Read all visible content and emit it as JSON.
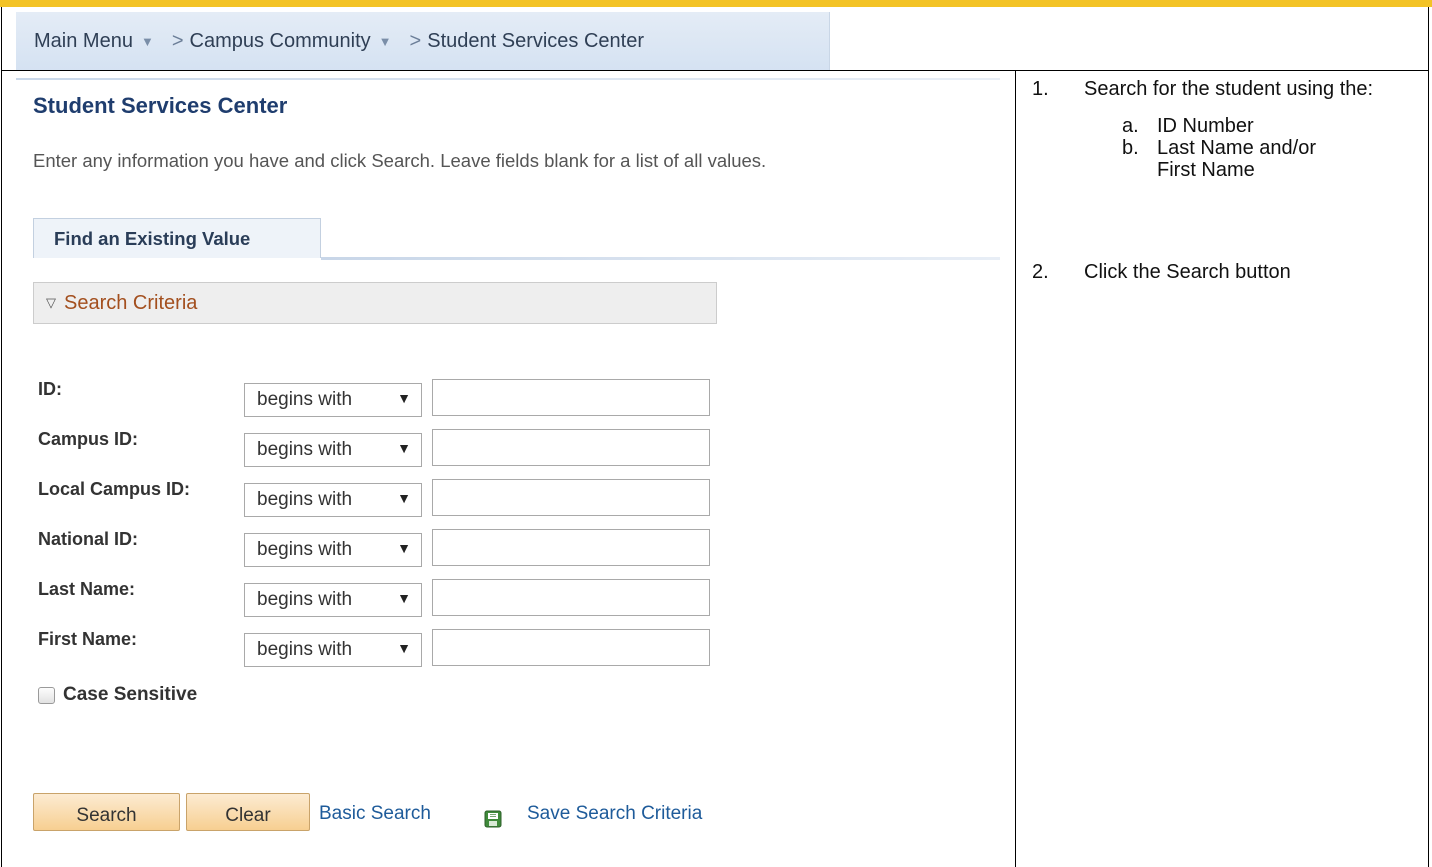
{
  "breadcrumb": {
    "items": [
      "Main Menu",
      "Campus Community",
      "Student Services Center"
    ]
  },
  "page": {
    "title": "Student Services Center",
    "instructions": "Enter any information you have and click Search. Leave fields blank for a list of all values."
  },
  "tab": {
    "label": "Find an Existing Value"
  },
  "criteria": {
    "header": "Search Criteria"
  },
  "fields": [
    {
      "label": "ID:",
      "operator": "begins with",
      "value": ""
    },
    {
      "label": "Campus ID:",
      "operator": "begins with",
      "value": ""
    },
    {
      "label": "Local Campus ID:",
      "operator": "begins with",
      "value": ""
    },
    {
      "label": "National ID:",
      "operator": "begins with",
      "value": ""
    },
    {
      "label": "Last Name:",
      "operator": "begins with",
      "value": ""
    },
    {
      "label": "First Name:",
      "operator": "begins with",
      "value": ""
    }
  ],
  "case_sensitive": {
    "label": "Case Sensitive",
    "checked": false
  },
  "buttons": {
    "search": "Search",
    "clear": "Clear",
    "basic_search": "Basic Search",
    "save_criteria": "Save Search Criteria"
  },
  "steps": [
    {
      "num": "1.",
      "text": "Search for the student using the:",
      "subs": [
        {
          "letter": "a.",
          "text": "ID Number"
        },
        {
          "letter": "b.",
          "text": "Last Name and/or First Name"
        }
      ]
    },
    {
      "num": "2.",
      "text": "Click the Search button"
    }
  ],
  "colors": {
    "accent_gold": "#f3c326",
    "title_blue": "#1f3d6e",
    "criteria_orange": "#a34f1e",
    "link_blue": "#1e5b9a",
    "button_fill": "#f7cf91"
  }
}
